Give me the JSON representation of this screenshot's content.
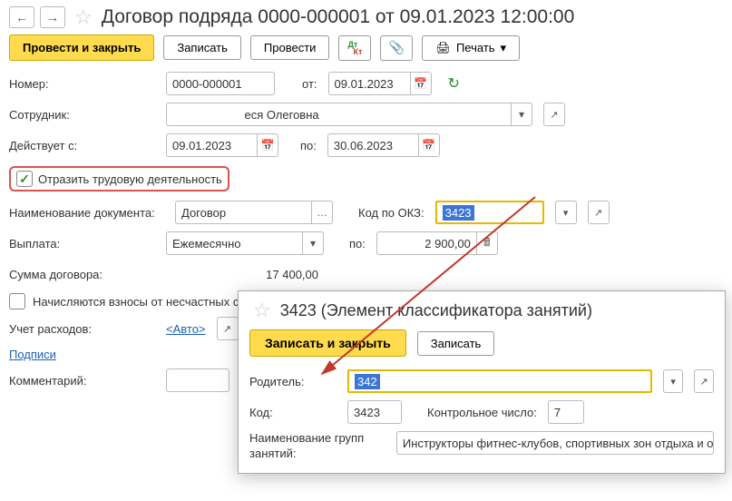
{
  "header": {
    "title": "Договор подряда 0000-000001 от 09.01.2023 12:00:00"
  },
  "toolbar": {
    "post_close": "Провести и закрыть",
    "save": "Записать",
    "post": "Провести",
    "print": "Печать"
  },
  "fields": {
    "number_label": "Номер:",
    "number_value": "0000-000001",
    "from_label": "от:",
    "from_date": "09.01.2023",
    "employee_label": "Сотрудник:",
    "employee_value": "                      еся Олеговна",
    "valid_from_label": "Действует с:",
    "valid_from": "09.01.2023",
    "to_label": "по:",
    "valid_to": "30.06.2023",
    "reflect_label": "Отразить трудовую деятельность",
    "docname_label": "Наименование документа:",
    "docname_value": "Договор",
    "okz_label": "Код по ОКЗ:",
    "okz_value": "3423",
    "payment_label": "Выплата:",
    "payment_value": "Ежемесячно",
    "by_label": "по:",
    "amount": "2 900,00",
    "total_label": "Сумма договора:",
    "total_value": "17 400,00",
    "accident_label": "Начисляются взносы от несчастных случаев",
    "account_label": "Учет расходов:",
    "account_value": "<Авто>",
    "signs": "Подписи",
    "comment_label": "Комментарий:"
  },
  "popup": {
    "title": "3423 (Элемент классификатора занятий)",
    "save_close": "Записать и закрыть",
    "save": "Записать",
    "parent_label": "Родитель:",
    "parent_value": "342",
    "code_label": "Код:",
    "code_value": "3423",
    "check_label": "Контрольное число:",
    "check_value": "7",
    "name_label": "Наименование групп занятий:",
    "name_value": "Инструкторы фитнес-клубов, спортивных зон отдыха и организаторы"
  }
}
